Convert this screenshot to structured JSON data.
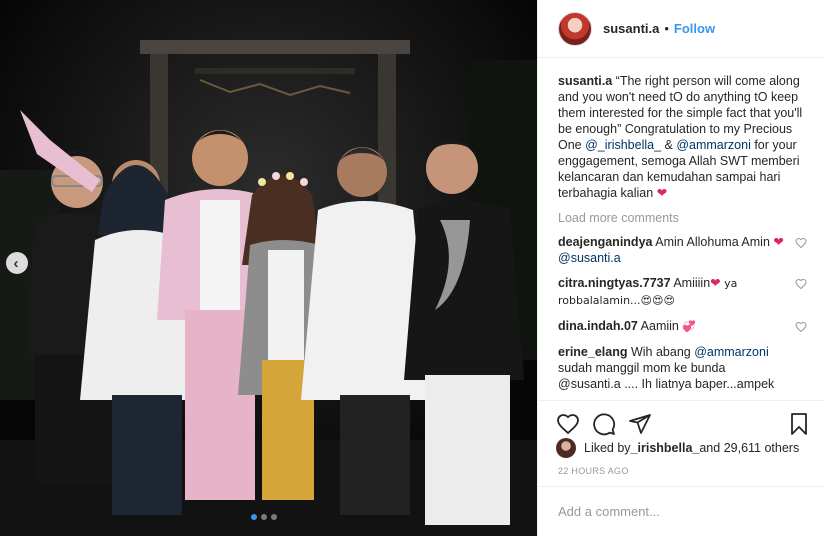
{
  "post": {
    "photo_alt": "Group photo of seven people at night",
    "carousel_dots": 3,
    "active_dot": 0
  },
  "header": {
    "username": "susanti.a",
    "separator": "•",
    "follow_label": "Follow"
  },
  "caption": {
    "username": "susanti.a",
    "text1": " “The right person will come along and you won't need tO do anything tO keep them interested for the simple fact that you'll be enough” Congratulation to my Precious One ",
    "mention1": "@_irishbella_",
    "text2": " & ",
    "mention2": "@ammarzoni",
    "text3": " for your enggagement, semoga Allah SWT memberi kelancaran dan kemudahan sampai hari terbahagia kalian ",
    "heart": "❤"
  },
  "load_more": "Load more comments",
  "comments": [
    {
      "user": "deajenganindya",
      "pre": " Amin Allohuma Amin ",
      "heart": "❤",
      "mention": "@susanti.a",
      "post": ""
    },
    {
      "user": "citra.ningtyas.7737",
      "pre": " Amiiiin",
      "heart": "❤",
      "mention": "",
      "post": " ya robbalalamin...😍😍😍"
    },
    {
      "user": "dina.indah.07",
      "pre": " Aamiin ",
      "heart": "",
      "mention": "",
      "post": "💞"
    },
    {
      "user": "erine_elang",
      "pre": " Wih abang ",
      "heart": "",
      "mention": "@ammarzoni",
      "post": " sudah manggil mom ke bunda @susanti.a .... Ih liatnya baper...ampek"
    }
  ],
  "likes": {
    "label": "Liked by ",
    "user": "_irishbella_",
    "rest": " and 29,611 others"
  },
  "timestamp": "22 HOURS AGO",
  "add_comment_placeholder": "Add a comment...",
  "icons": [
    "heart-icon",
    "comment-icon",
    "share-icon",
    "bookmark-icon",
    "chevron-left-icon"
  ]
}
